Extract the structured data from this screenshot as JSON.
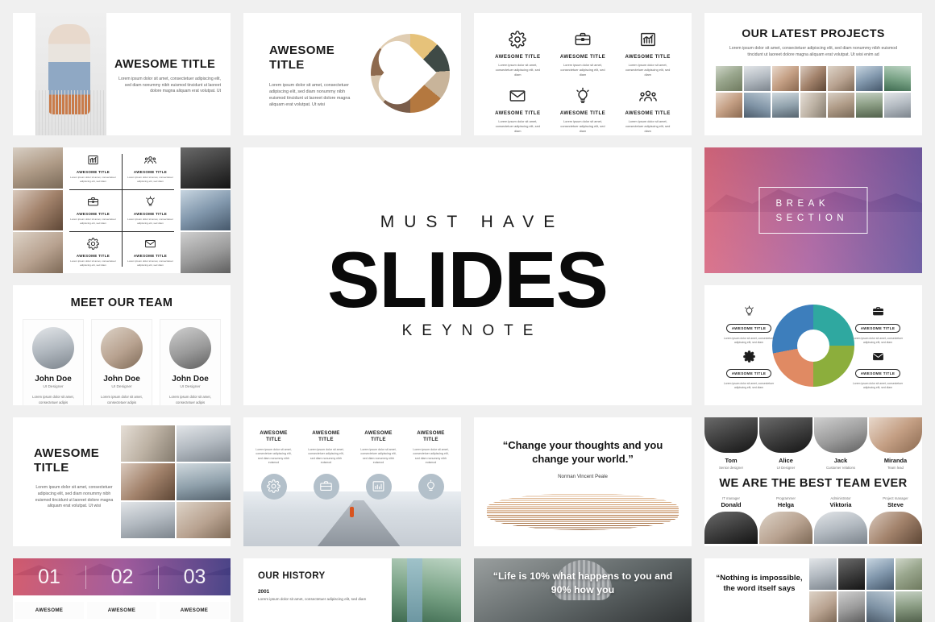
{
  "common": {
    "awesome_title": "AWESOME TITLE",
    "lorem_short": "Lorem ipsum dolor sit amet, consectetuer adipiscing elit, sed diam",
    "lorem_medium": "Lorem ipsum dolor sit amet, consectetuer adipiscing elit, sed diam nonummy nibh euismod tincidunt ut laoreet dolore magna aliquam erat volutpat. Ut wisi",
    "lorem_tiny": "Lorem ipsum dolor sit amet, consectetuer adipiscing elit, sed diam"
  },
  "slide_fashion": {
    "title": "AWESOME TITLE",
    "body": "Lorem ipsum dolor sit amet, consectetuer adipiscing elit, sed diam nonummy nibh euismod tincidunt ut laoreet dolore magna aliquam erat volutpat. Ut"
  },
  "slide_food": {
    "title": "AWESOME TITLE",
    "body": "Lorem ipsum dolor sit amet, consectetuer adipiscing elit, sed diam nonummy nibh euismod tincidunt ut laoreet dolore magna aliquam erat volutpat. Ut wisi"
  },
  "slide_icons6": {
    "items": [
      {
        "icon": "gear-icon",
        "title": "AWESOME TITLE",
        "body": "Lorem ipsum dolor sit amet, consectetuer adipiscing elit, sed diam"
      },
      {
        "icon": "briefcase-icon",
        "title": "AWESOME TITLE",
        "body": "Lorem ipsum dolor sit amet, consectetuer adipiscing elit, sed diam"
      },
      {
        "icon": "bar-chart-icon",
        "title": "AWESOME TITLE",
        "body": "Lorem ipsum dolor sit amet, consectetuer adipiscing elit, sed diam"
      },
      {
        "icon": "envelope-icon",
        "title": "AWESOME TITLE",
        "body": "Lorem ipsum dolor sit amet, consectetuer adipiscing elit, sed diam"
      },
      {
        "icon": "lightbulb-icon",
        "title": "AWESOME TITLE",
        "body": "Lorem ipsum dolor sit amet, consectetuer adipiscing elit, sed diam"
      },
      {
        "icon": "people-icon",
        "title": "AWESOME TITLE",
        "body": "Lorem ipsum dolor sit amet, consectetuer adipiscing elit, sed diam"
      }
    ]
  },
  "slide_projects": {
    "title": "OUR LATEST PROJECTS",
    "body": "Lorem ipsum dolor sit amet, consectetuer adipiscing elit, sed diam nonummy nibh euismod tincidunt ut laoreet dolore magna aliquam erat volutpat. Ut wisi enim ad"
  },
  "slide_icongrid": {
    "items": [
      {
        "icon": "bar-chart-icon",
        "title": "AWESOME TITLE",
        "body": "Lorem ipsum dolor sit amet, consectetuer adipiscing elit, sed diam"
      },
      {
        "icon": "people-icon",
        "title": "AWESOME TITLE",
        "body": "Lorem ipsum dolor sit amet, consectetuer adipiscing elit, sed diam"
      },
      {
        "icon": "briefcase-icon",
        "title": "AWESOME TITLE",
        "body": "Lorem ipsum dolor sit amet, consectetuer adipiscing elit, sed diam"
      },
      {
        "icon": "lightbulb-icon",
        "title": "AWESOME TITLE",
        "body": "Lorem ipsum dolor sit amet, consectetuer adipiscing elit, sed diam"
      },
      {
        "icon": "gear-icon",
        "title": "AWESOME TITLE",
        "body": "Lorem ipsum dolor sit amet, consectetuer adipiscing elit, sed diam"
      },
      {
        "icon": "envelope-icon",
        "title": "AWESOME TITLE",
        "body": "Lorem ipsum dolor sit amet, consectetuer adipiscing elit, sed diam"
      }
    ]
  },
  "slide_hero": {
    "kicker": "MUST HAVE",
    "title": "SLIDES",
    "subtitle": "KEYNOTE"
  },
  "slide_break": {
    "label": "BREAK SECTION"
  },
  "slide_team": {
    "title": "MEET OUR TEAM",
    "members": [
      {
        "name": "John Doe",
        "role": "UI Designer",
        "bio": "Lorem ipsum dolor sit amet, consectetuer adipis"
      },
      {
        "name": "John Doe",
        "role": "UI Designer",
        "bio": "Lorem ipsum dolor sit amet, consectetuer adipis"
      },
      {
        "name": "John Doe",
        "role": "UI Designer",
        "bio": "Lorem ipsum dolor sit amet, consectetuer adipis"
      }
    ]
  },
  "slide_donut": {
    "nodes": [
      {
        "icon": "lightbulb-icon",
        "title": "AWESOME TITLE",
        "body": "Lorem ipsum dolor sit amet, consectetuer adipiscing elit, sed diam"
      },
      {
        "icon": "briefcase-icon",
        "title": "AWESOME TITLE",
        "body": "Lorem ipsum dolor sit amet, consectetuer adipiscing elit, sed diam"
      },
      {
        "icon": "gear-icon",
        "title": "AWESOME TITLE",
        "body": "Lorem ipsum dolor sit amet, consectetuer adipiscing elit, sed diam"
      },
      {
        "icon": "envelope-icon",
        "title": "AWESOME TITLE",
        "body": "Lorem ipsum dolor sit amet, consectetuer adipiscing elit, sed diam"
      }
    ]
  },
  "slide_interior": {
    "title": "AWESOME TITLE",
    "body": "Lorem ipsum dolor sit amet, consectetuer adipiscing elit, sed diam nonummy nibh euismod tincidunt ut laoreet dolore magna aliquam erat volutpat. Ut wisi"
  },
  "slide_cards4": {
    "cards": [
      {
        "icon": "gear-icon",
        "title": "AWESOME TITLE",
        "body": "Lorem ipsum dolor sit amet, consectetuer adipiscing elit, sed diam nonummy nibh euismod"
      },
      {
        "icon": "briefcase-icon",
        "title": "AWESOME TITLE",
        "body": "Lorem ipsum dolor sit amet, consectetuer adipiscing elit, sed diam nonummy nibh euismod"
      },
      {
        "icon": "bar-chart-icon",
        "title": "AWESOME TITLE",
        "body": "Lorem ipsum dolor sit amet, consectetuer adipiscing elit, sed diam nonummy nibh euismod"
      },
      {
        "icon": "lightbulb-icon",
        "title": "AWESOME TITLE",
        "body": "Lorem ipsum dolor sit amet, consectetuer adipiscing elit, sed diam nonummy nibh euismod"
      }
    ]
  },
  "slide_quote_peale": {
    "quote": "“Change your thoughts and you change your world.”",
    "author": "Norman Vincent Peale"
  },
  "slide_bestteam": {
    "title": "WE ARE THE BEST TEAM EVER",
    "top": [
      {
        "name": "Tom",
        "role": "Senior designer"
      },
      {
        "name": "Alice",
        "role": "UI Designer"
      },
      {
        "name": "Jack",
        "role": "Customer relations"
      },
      {
        "name": "Miranda",
        "role": "Team lead"
      }
    ],
    "bottom": [
      {
        "name": "Donald",
        "role": "IT manager"
      },
      {
        "name": "Helga",
        "role": "Programmer"
      },
      {
        "name": "Viktoria",
        "role": "Administrator"
      },
      {
        "name": "Steve",
        "role": "Project manager"
      }
    ]
  },
  "slide_numbers": {
    "numbers": [
      "01",
      "02",
      "03"
    ],
    "labels": [
      "AWESOME",
      "AWESOME",
      "AWESOME"
    ]
  },
  "slide_history": {
    "title": "OUR HISTORY",
    "year": "2001",
    "body": "Lorem ipsum dolor sit amet, consectetuer adipiscing elit, sed diam"
  },
  "slide_quote_life": {
    "quote": "“Life is 10% what happens to you and 90% how you"
  },
  "slide_quote_nothing": {
    "quote": "“Nothing is impossible, the word itself says"
  },
  "colors": {
    "page_bg": "#f0f0f0",
    "slide_bg": "#ffffff",
    "ink": "#1a1a1a",
    "muted": "#6b6b6b",
    "break_gradient_start": "#e0485c",
    "break_gradient_mid": "#9c3e8c",
    "break_gradient_end": "#4a348c",
    "badge_gray": "#b3c0ca",
    "donut_teal": "#2fa8a0",
    "donut_green": "#8cae3c",
    "donut_orange": "#e08a63",
    "donut_blue": "#3d7ebc"
  }
}
